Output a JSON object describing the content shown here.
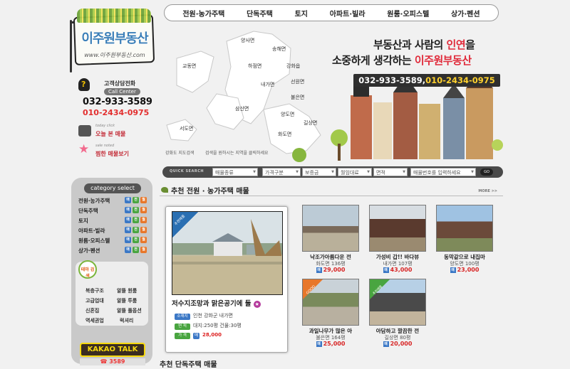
{
  "logo": {
    "name": "이주원부동산",
    "url": "www.이주원부동산.com"
  },
  "menu": [
    "전원·농가주택",
    "단독주택",
    "토지",
    "아파트·빌라",
    "원룸·오피스텔",
    "상가·펜션"
  ],
  "contact": {
    "title": "고객상담전화",
    "badge": "Call Center",
    "tel1": "032-933-3589",
    "tel2": "010-2434-0975"
  },
  "quick": [
    {
      "mini": "today click",
      "label": "오늘 본 매물"
    },
    {
      "mini": "sale noted",
      "label": "찜한 매물보기"
    }
  ],
  "map": {
    "towns": [
      "양사면",
      "송해면",
      "교동면",
      "하점면",
      "강화읍",
      "내가면",
      "선원면",
      "불은면",
      "삼산면",
      "양도면",
      "길상면",
      "서도면",
      "화도면"
    ],
    "btn1": "강화도 지도검색",
    "btn2": "검색을 원하시는 지역을 클릭하세요"
  },
  "slogan": {
    "l1a": "부동산과 사람의 ",
    "l1b": "인연",
    "l1c": "을",
    "l2a": "소중하게 생각하는 ",
    "l2b": "이주원부동산",
    "tel_a": "032-933-3589,",
    "tel_b": "010-2434-0975"
  },
  "search": {
    "title": "QUICK SEARCH",
    "type": "매물종류",
    "price": "가격구분",
    "deposit": "보증금",
    "rent": "월임대료",
    "area": "면적",
    "placeholder": "매물번호를 입력하세요",
    "go": "GO"
  },
  "category": {
    "title": "category select",
    "items": [
      "전원·농가주택",
      "단독주택",
      "토지",
      "아파트·빌라",
      "원룸·오피스텔",
      "상가·펜션"
    ],
    "tags": [
      "매",
      "전",
      "월"
    ],
    "bubble": "테마 검색",
    "links": [
      "복층구조",
      "알뜰 원룸",
      "고급업대",
      "알뜰 투룸",
      "신혼집",
      "알뜰 풀옵션",
      "역세권업",
      "럭셔리"
    ]
  },
  "kakao": {
    "label": "KAKAO TALK",
    "sub": "☎ 3589"
  },
  "section": {
    "title": "추천 전원 · 농가주택 매물",
    "more": "MORE >>",
    "next": "추천 단독주택 매물"
  },
  "featured": {
    "ribbon": "추천매물",
    "title": "저수지조망과 맑은공기에 둘",
    "addr_lbl": "소재지",
    "addr": "인천 강화군 내가면",
    "size_lbl": "면 적",
    "size": "대지:250평 건물:30평",
    "price_lbl": "가 격",
    "price": "28,000",
    "price_tag": "매"
  },
  "listings": [
    {
      "n1": "낙조가아름다운 전",
      "n2": "화도면 136평",
      "price": "29,000"
    },
    {
      "n1": "가성비 갑!! 바다뷰",
      "n2": "내가면 107평",
      "price": "43,000"
    },
    {
      "n1": "동막같으로 내집마",
      "n2": "양도면 100평",
      "price": "23,000"
    },
    {
      "n1": "과일나무가 많은 아",
      "n2": "불은면 164평",
      "price": "25,000",
      "badge": "GOOD"
    },
    {
      "n1": "아담하고 깔끔한 전",
      "n2": "길상면 80평",
      "price": "20,000",
      "badge": "추천매물"
    }
  ],
  "colors": {
    "accent": "#e02a3a",
    "blue": "#3b78c6",
    "red": "#d82626"
  }
}
